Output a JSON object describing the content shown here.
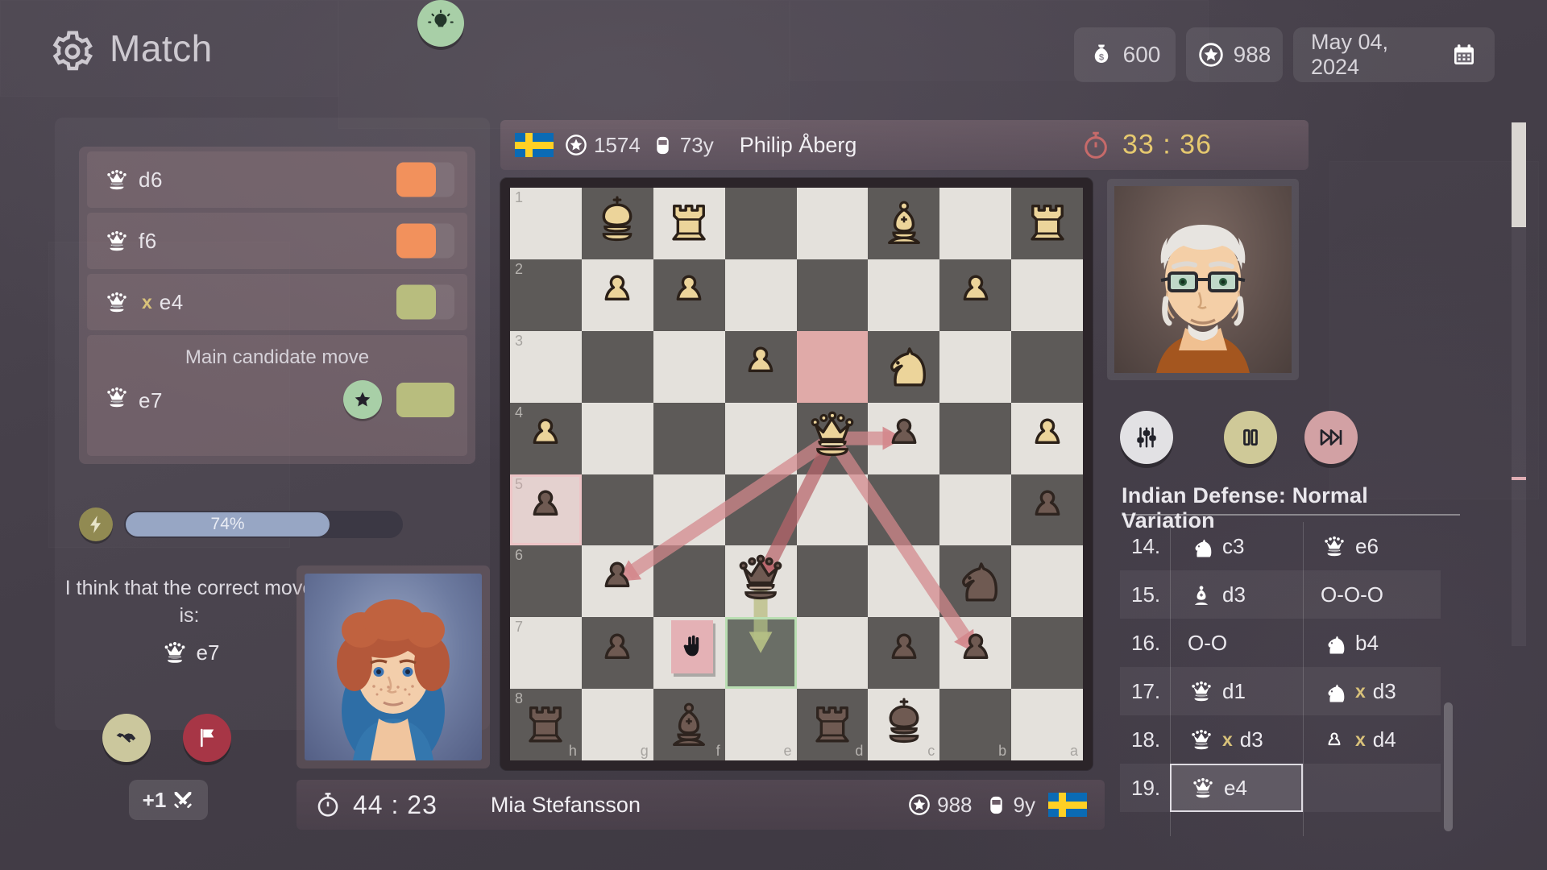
{
  "header": {
    "title": "Match",
    "gear_icon": "gear-icon",
    "coins": "600",
    "coins_icon": "money-bag-icon",
    "stars": "988",
    "stars_icon": "star-badge-icon",
    "date": "May 04, 2024",
    "calendar_icon": "calendar-icon"
  },
  "left_panel": {
    "candidates": [
      {
        "piece": "queen",
        "move": "d6",
        "capture": false,
        "eval_color": "#f2915c"
      },
      {
        "piece": "queen",
        "move": "f6",
        "capture": false,
        "eval_color": "#f2915c"
      },
      {
        "piece": "queen",
        "move": "e4",
        "capture": true,
        "capture_mark": "x",
        "eval_color": "#b8bd7e"
      }
    ],
    "main_candidate": {
      "title": "Main candidate move",
      "piece": "queen",
      "move": "e7",
      "star_icon": "star-icon",
      "eval_color": "#b8bd7e"
    },
    "progress": {
      "bolt_icon": "bolt-icon",
      "percent_label": "74%",
      "percent_value": 74,
      "fill_color": "#97a6c4"
    },
    "hint_button": {
      "icon": "lightbulb-icon",
      "color": "#a8cfa7"
    },
    "advice": {
      "text": "I think that the correct move is:",
      "piece": "queen",
      "move": "e7"
    },
    "actions": {
      "draw": {
        "icon": "handshake-icon",
        "color": "#cbc79d"
      },
      "resign": {
        "icon": "flag-icon",
        "color": "#a73646"
      },
      "bonus": {
        "label": "+1",
        "icon": "crossed-swords-icon"
      }
    },
    "player_card": {
      "avatar": "mia-avatar",
      "clock_icon": "stopwatch-icon",
      "clock": "44 : 23"
    }
  },
  "board_area": {
    "top_player": {
      "flag": "sweden-flag",
      "rating_icon": "star-badge-icon",
      "rating": "1574",
      "age_icon": "hourglass-icon",
      "age": "73y",
      "name": "Philip Åberg",
      "clock_icon": "stopwatch-icon",
      "clock": "33 : 36",
      "clock_color": "#e6c96f"
    },
    "bottom_player": {
      "flag": "sweden-flag",
      "rating_icon": "star-badge-icon",
      "rating": "988",
      "age_icon": "hourglass-icon",
      "age": "9y",
      "name": "Mia Stefansson",
      "clock_icon": "stopwatch-icon",
      "clock": "44 : 23"
    },
    "board": {
      "orientation": "black-bottom-flipped",
      "files": [
        "h",
        "g",
        "f",
        "e",
        "d",
        "c",
        "b",
        "a"
      ],
      "ranks": [
        "1",
        "2",
        "3",
        "4",
        "5",
        "6",
        "7",
        "8"
      ],
      "light_color": "#e4e1dc",
      "dark_color": "#5d5a58",
      "pieces": [
        {
          "col": 1,
          "row": 0,
          "type": "king",
          "side": "white"
        },
        {
          "col": 2,
          "row": 0,
          "type": "rook",
          "side": "white"
        },
        {
          "col": 5,
          "row": 0,
          "type": "bishop",
          "side": "white"
        },
        {
          "col": 7,
          "row": 0,
          "type": "rook",
          "side": "white"
        },
        {
          "col": 1,
          "row": 1,
          "type": "pawn",
          "side": "white"
        },
        {
          "col": 2,
          "row": 1,
          "type": "pawn",
          "side": "white"
        },
        {
          "col": 6,
          "row": 1,
          "type": "pawn",
          "side": "white"
        },
        {
          "col": 3,
          "row": 2,
          "type": "pawn",
          "side": "white"
        },
        {
          "col": 5,
          "row": 2,
          "type": "knight",
          "side": "white"
        },
        {
          "col": 0,
          "row": 3,
          "type": "pawn",
          "side": "white"
        },
        {
          "col": 4,
          "row": 3,
          "type": "queen",
          "side": "white"
        },
        {
          "col": 5,
          "row": 3,
          "type": "pawn",
          "side": "black"
        },
        {
          "col": 7,
          "row": 3,
          "type": "pawn",
          "side": "white"
        },
        {
          "col": 0,
          "row": 4,
          "type": "pawn",
          "side": "black"
        },
        {
          "col": 7,
          "row": 4,
          "type": "pawn",
          "side": "black"
        },
        {
          "col": 1,
          "row": 5,
          "type": "pawn",
          "side": "black"
        },
        {
          "col": 3,
          "row": 5,
          "type": "queen",
          "side": "black"
        },
        {
          "col": 6,
          "row": 5,
          "type": "knight",
          "side": "black"
        },
        {
          "col": 1,
          "row": 6,
          "type": "pawn",
          "side": "black"
        },
        {
          "col": 5,
          "row": 6,
          "type": "pawn",
          "side": "black"
        },
        {
          "col": 6,
          "row": 6,
          "type": "pawn",
          "side": "black"
        },
        {
          "col": 0,
          "row": 7,
          "type": "rook",
          "side": "black"
        },
        {
          "col": 2,
          "row": 7,
          "type": "bishop",
          "side": "black"
        },
        {
          "col": 4,
          "row": 7,
          "type": "rook",
          "side": "black"
        },
        {
          "col": 5,
          "row": 7,
          "type": "king",
          "side": "black"
        }
      ],
      "highlights": {
        "red_square": {
          "col": 4,
          "row": 2
        },
        "pink_border": {
          "col": 0,
          "row": 4
        },
        "green_target": {
          "col": 3,
          "row": 6
        }
      },
      "arrows": [
        {
          "from": [
            4,
            3
          ],
          "to": [
            5,
            3
          ],
          "color": "#d4888c"
        },
        {
          "from": [
            4,
            3
          ],
          "to": [
            1,
            5
          ],
          "color": "#d4888c"
        },
        {
          "from": [
            4,
            3
          ],
          "to": [
            6,
            6
          ],
          "color": "#d4888c"
        },
        {
          "from": [
            4,
            3
          ],
          "to": [
            3,
            5
          ],
          "color": "#b8656b"
        },
        {
          "from": [
            3,
            5
          ],
          "to": [
            3,
            6
          ],
          "color": "#b8bd7e"
        }
      ],
      "cursor": {
        "col": 2,
        "row": 6,
        "icon": "hand-pointer-icon"
      }
    }
  },
  "right_panel": {
    "opponent_avatar": "philip-avatar",
    "controls": [
      {
        "name": "settings-sliders",
        "icon": "sliders-icon",
        "color": "#e2e1e4"
      },
      {
        "name": "pause",
        "icon": "pause-icon",
        "color": "#cfc998"
      },
      {
        "name": "fast-forward",
        "icon": "fast-forward-icon",
        "color": "#d2a1a4"
      }
    ],
    "opening": "Indian Defense: Normal Variation",
    "moves": [
      {
        "no": "14.",
        "white": {
          "piece": "knight",
          "text": "c3"
        },
        "black": {
          "piece": "queen",
          "text": "e6"
        }
      },
      {
        "no": "15.",
        "white": {
          "piece": "bishop",
          "text": "d3"
        },
        "black": {
          "piece": null,
          "text": "O-O-O"
        }
      },
      {
        "no": "16.",
        "white": {
          "piece": null,
          "text": "O-O"
        },
        "black": {
          "piece": "knight",
          "text": "b4"
        }
      },
      {
        "no": "17.",
        "white": {
          "piece": "queen",
          "text": "d1"
        },
        "black": {
          "piece": "knight",
          "text": "d3",
          "capture": "x"
        }
      },
      {
        "no": "18.",
        "white": {
          "piece": "queen",
          "text": "d3",
          "capture": "x"
        },
        "black": {
          "piece": "pawn",
          "text": "d4",
          "capture": "x"
        }
      },
      {
        "no": "19.",
        "white": {
          "piece": "queen",
          "text": "e4",
          "selected": true
        },
        "black": {
          "piece": null,
          "text": ""
        }
      }
    ]
  }
}
